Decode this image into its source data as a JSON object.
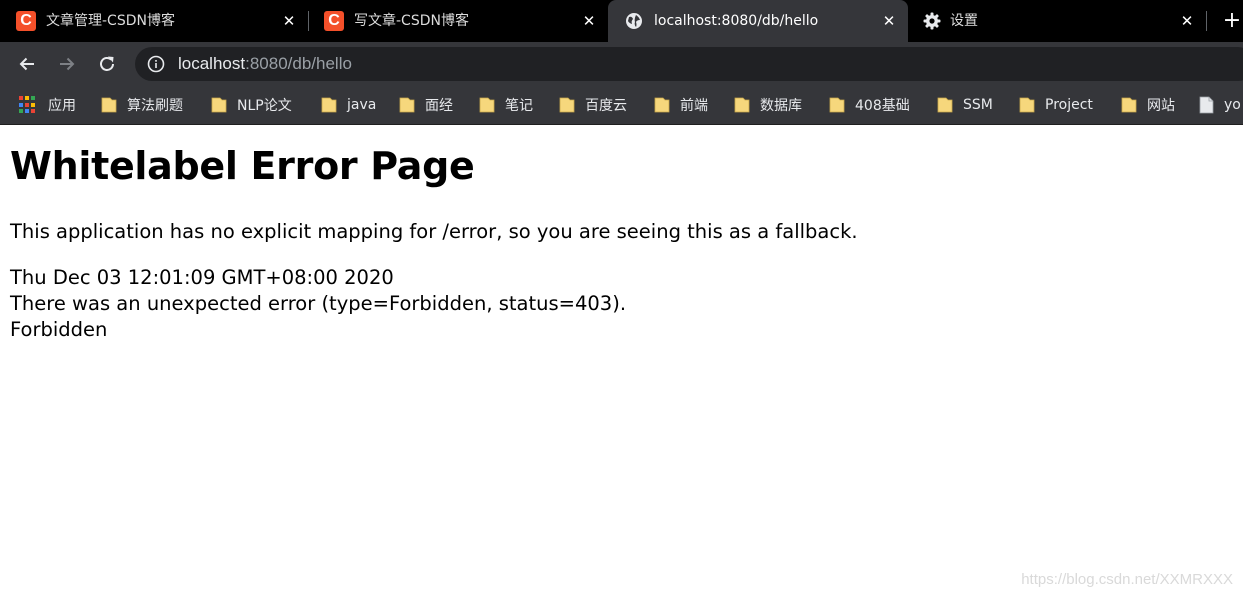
{
  "tabs": [
    {
      "title": "文章管理-CSDN博客",
      "favicon": "csdn-logo-icon",
      "favicon_letter": "C"
    },
    {
      "title": "写文章-CSDN博客",
      "favicon": "csdn-logo-icon",
      "favicon_letter": "C"
    },
    {
      "title": "localhost:8080/db/hello",
      "favicon": "globe-icon",
      "active": true
    },
    {
      "title": "设置",
      "favicon": "gear-icon"
    }
  ],
  "tab_close_glyph": "✕",
  "new_tab_glyph": "+",
  "address_bar": {
    "host": "localhost",
    "path": ":8080/db/hello"
  },
  "bookmarks": [
    {
      "label": "应用",
      "icon": "apps-grid-icon"
    },
    {
      "label": "算法刷题",
      "icon": "folder-icon"
    },
    {
      "label": "NLP论文",
      "icon": "folder-icon"
    },
    {
      "label": "java",
      "icon": "folder-icon"
    },
    {
      "label": "面经",
      "icon": "folder-icon"
    },
    {
      "label": "笔记",
      "icon": "folder-icon"
    },
    {
      "label": "百度云",
      "icon": "folder-icon"
    },
    {
      "label": "前端",
      "icon": "folder-icon"
    },
    {
      "label": "数据库",
      "icon": "folder-icon"
    },
    {
      "label": "408基础",
      "icon": "folder-icon"
    },
    {
      "label": "SSM",
      "icon": "folder-icon"
    },
    {
      "label": "Project",
      "icon": "folder-icon"
    },
    {
      "label": "网站",
      "icon": "folder-icon"
    },
    {
      "label": "yo",
      "icon": "page-icon"
    }
  ],
  "page": {
    "heading": "Whitelabel Error Page",
    "message": "This application has no explicit mapping for /error, so you are seeing this as a fallback.",
    "timestamp": "Thu Dec 03 12:01:09 GMT+08:00 2020",
    "error_detail": "There was an unexpected error (type=Forbidden, status=403).",
    "error_reason": "Forbidden"
  },
  "watermark": "https://blog.csdn.net/XXMRXXX",
  "colors": {
    "tab_strip": "#000000",
    "toolbar": "#35363a",
    "omnibox": "#202124",
    "csdn_red": "#f4502a",
    "folder_yellow": "#f6d77c"
  }
}
